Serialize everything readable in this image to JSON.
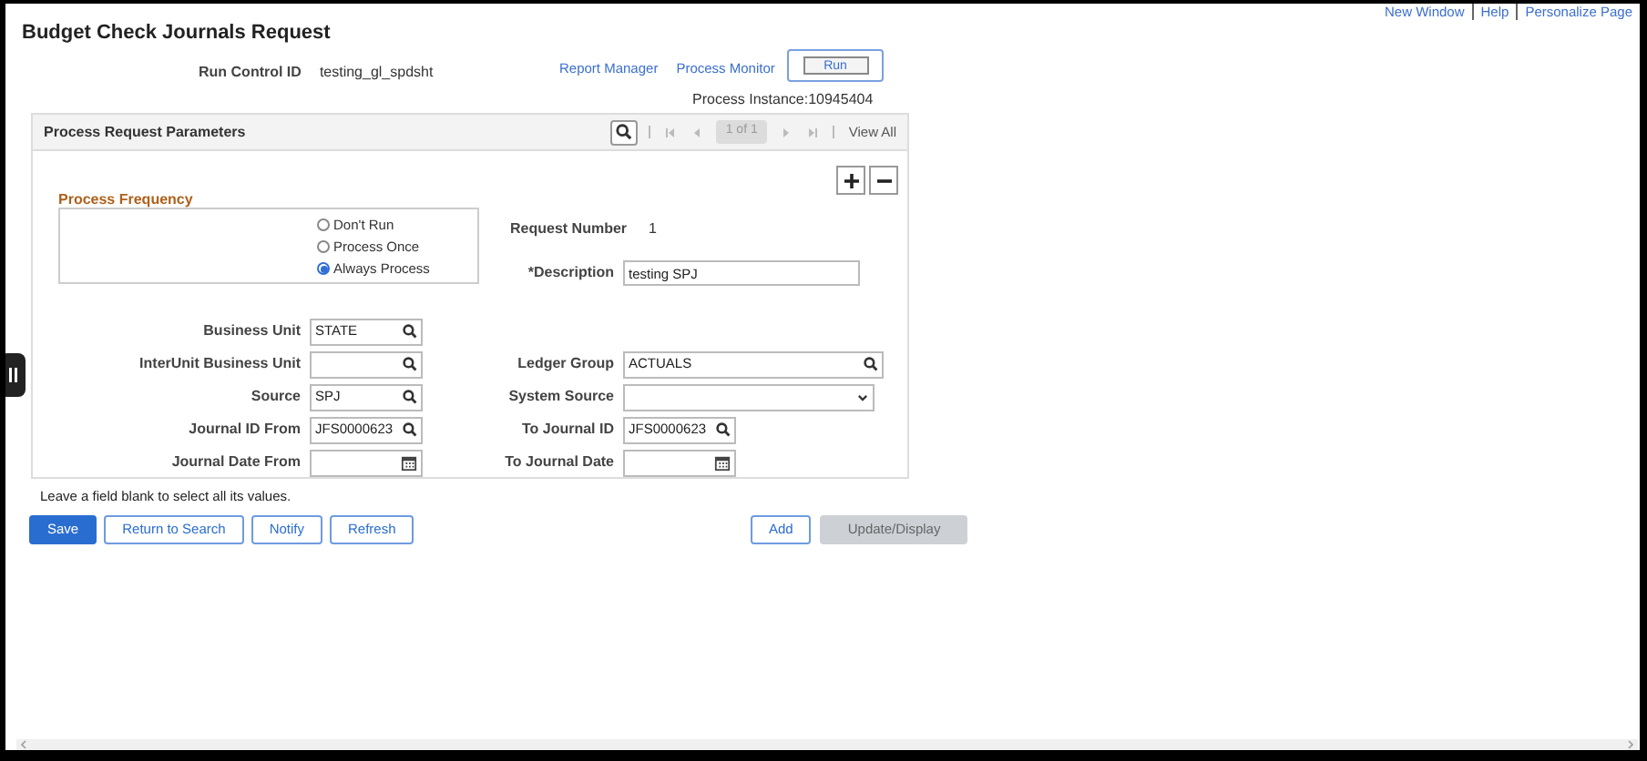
{
  "top_links": [
    "New Window",
    "Help",
    "Personalize Page"
  ],
  "title": "Budget Check Journals Request",
  "run_control": {
    "label": "Run Control ID",
    "value": "testing_gl_spdsht"
  },
  "header_links": [
    "Report Manager",
    "Process Monitor"
  ],
  "run_button": "Run",
  "process_instance": "Process Instance:10945404",
  "panel": {
    "title": "Process Request Parameters",
    "pager": "1 of 1",
    "view_all": "View All",
    "frequency": {
      "title": "Process Frequency",
      "options": [
        {
          "label": "Don't Run",
          "selected": false
        },
        {
          "label": "Process Once",
          "selected": false
        },
        {
          "label": "Always Process",
          "selected": true
        }
      ]
    },
    "request_number": {
      "label": "Request Number",
      "value": "1"
    },
    "description": {
      "label": "*Description",
      "value": "testing SPJ"
    },
    "rows": [
      {
        "left": {
          "label": "Business Unit",
          "value": "STATE",
          "kind": "lookup"
        }
      },
      {
        "left": {
          "label": "InterUnit Business Unit",
          "kind": "lookup"
        },
        "right": {
          "label": "Ledger Group",
          "value": "ACTUALS",
          "kind": "lookup",
          "wide": true
        }
      },
      {
        "left": {
          "label": "Source",
          "value": "SPJ",
          "kind": "lookup"
        },
        "right": {
          "label": "System Source",
          "kind": "dropdown",
          "wide": true
        }
      },
      {
        "left": {
          "label": "Journal ID From",
          "value": "JFS0000623",
          "kind": "lookup"
        },
        "right": {
          "label": "To Journal ID",
          "value": "JFS0000623",
          "kind": "lookup",
          "wide": false
        }
      },
      {
        "left": {
          "label": "Journal Date From",
          "kind": "date"
        },
        "right": {
          "label": "To Journal Date",
          "kind": "date",
          "wide": false
        }
      }
    ]
  },
  "note": "Leave a field blank to select all its values.",
  "buttons_left": [
    {
      "label": "Save",
      "kind": "primary"
    },
    {
      "label": "Return to Search",
      "kind": "outline"
    },
    {
      "label": "Notify",
      "kind": "outline"
    },
    {
      "label": "Refresh",
      "kind": "outline"
    }
  ],
  "buttons_right": [
    {
      "label": "Add",
      "kind": "outline"
    },
    {
      "label": "Update/Display",
      "kind": "disabled"
    }
  ]
}
